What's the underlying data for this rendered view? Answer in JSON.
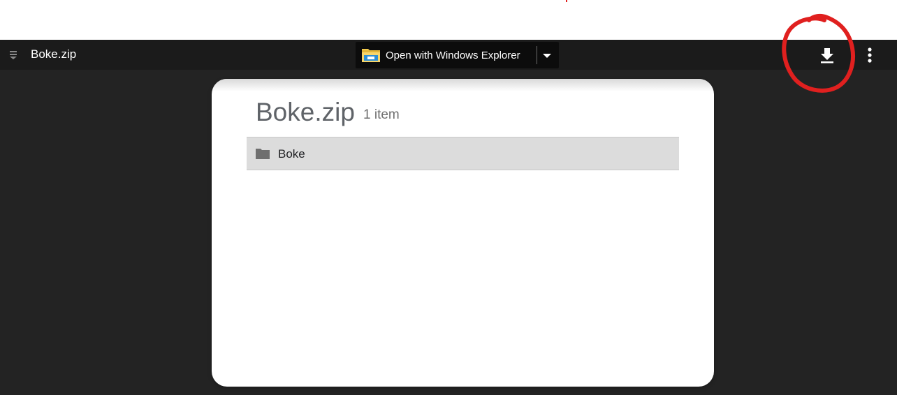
{
  "header": {
    "file_title": "Boke.zip",
    "open_with": {
      "label": "Open with Windows Explorer",
      "icon": "file-explorer-icon",
      "dropdown_icon": "caret-down-icon"
    },
    "actions": [
      {
        "name": "download",
        "icon": "download-icon"
      },
      {
        "name": "more",
        "icon": "more-vert-icon"
      }
    ]
  },
  "card": {
    "title": "Boke.zip",
    "count": "1 item",
    "items": [
      {
        "label": "Boke",
        "icon": "folder-icon"
      }
    ]
  },
  "annotation": {
    "color": "#e0201f",
    "shape": "hand-drawn circle around download button"
  },
  "colors": {
    "viewer_bg": "#232323",
    "header_bg": "#1b1b1b",
    "card_bg": "#ffffff",
    "row_bg": "#dcdcdc"
  }
}
